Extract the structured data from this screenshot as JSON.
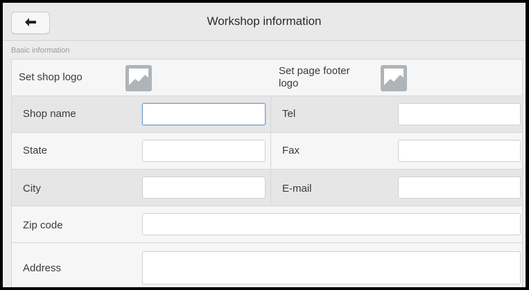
{
  "header": {
    "title": "Workshop information",
    "back_icon": "back-arrow-icon"
  },
  "section": {
    "label": "Basic information"
  },
  "logos": {
    "shop_logo_label": "Set shop logo",
    "footer_logo_label": "Set page footer logo",
    "icon": "image-placeholder-icon"
  },
  "fields": {
    "shop_name": {
      "label": "Shop name",
      "value": ""
    },
    "tel": {
      "label": "Tel",
      "value": ""
    },
    "state": {
      "label": "State",
      "value": ""
    },
    "fax": {
      "label": "Fax",
      "value": ""
    },
    "city": {
      "label": "City",
      "value": ""
    },
    "email": {
      "label": "E-mail",
      "value": ""
    },
    "zip": {
      "label": "Zip code",
      "value": ""
    },
    "address": {
      "label": "Address",
      "value": ""
    }
  },
  "colors": {
    "focus_border": "#6e9bd2",
    "icon_fill": "#aeb4b8"
  }
}
